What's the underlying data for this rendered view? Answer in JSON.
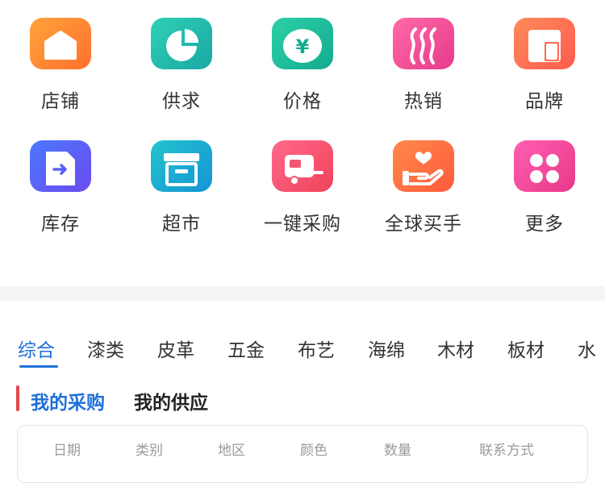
{
  "grid": {
    "items": [
      {
        "label": "店铺",
        "icon": "shop-icon",
        "gradient": [
          "#ffa43a",
          "#ff6f2e"
        ]
      },
      {
        "label": "供求",
        "icon": "pie-chart-icon",
        "gradient": [
          "#2fd1b6",
          "#1aa7a4"
        ]
      },
      {
        "label": "价格",
        "icon": "yuan-icon",
        "gradient": [
          "#2bd1a8",
          "#13ab8e"
        ]
      },
      {
        "label": "热销",
        "icon": "flame-icon",
        "gradient": [
          "#ff6aa8",
          "#e73a8a"
        ]
      },
      {
        "label": "品牌",
        "icon": "brand-icon",
        "gradient": [
          "#ff8a5a",
          "#ff5b4f"
        ]
      },
      {
        "label": "库存",
        "icon": "inventory-icon",
        "gradient": [
          "#4c78ff",
          "#6b4bf0"
        ]
      },
      {
        "label": "超市",
        "icon": "supermarket-icon",
        "gradient": [
          "#23c4cd",
          "#1593d6"
        ]
      },
      {
        "label": "一键采购",
        "icon": "camper-icon",
        "gradient": [
          "#ff6a8b",
          "#f0425a"
        ]
      },
      {
        "label": "全球买手",
        "icon": "hand-heart-icon",
        "gradient": [
          "#ff8a4a",
          "#ff5a3c"
        ]
      },
      {
        "label": "更多",
        "icon": "more-icon",
        "gradient": [
          "#ff5fb0",
          "#e8388b"
        ]
      }
    ]
  },
  "tabs": {
    "items": [
      "综合",
      "漆类",
      "皮革",
      "五金",
      "布艺",
      "海绵",
      "木材",
      "板材",
      "水"
    ],
    "active_index": 0
  },
  "subtabs": {
    "items": [
      "我的采购",
      "我的供应"
    ],
    "active_index": 0
  },
  "table": {
    "headers": [
      "日期",
      "类别",
      "地区",
      "颜色",
      "数量",
      "联系方式"
    ]
  },
  "colors": {
    "accent": "#1e6fd9",
    "marker": "#e5484d"
  }
}
